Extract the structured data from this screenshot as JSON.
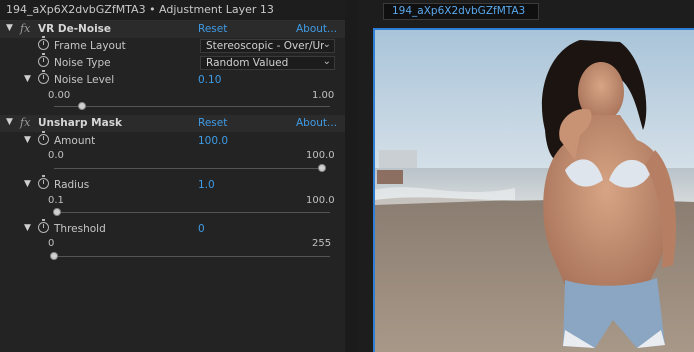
{
  "panel": {
    "title": "194_aXp6X2dvbGZfMTA3 • Adjustment Layer 13"
  },
  "effects": [
    {
      "name": "VR De-Noise",
      "reset": "Reset",
      "about": "About...",
      "params": {
        "frame_layout": {
          "label": "Frame Layout",
          "value": "Stereoscopic - Over/Under"
        },
        "noise_type": {
          "label": "Noise Type",
          "value": "Random Valued"
        },
        "noise_level": {
          "label": "Noise Level",
          "value": "0.10",
          "min": "0.00",
          "max": "1.00",
          "fraction": 0.1
        }
      }
    },
    {
      "name": "Unsharp Mask",
      "reset": "Reset",
      "about": "About...",
      "params": {
        "amount": {
          "label": "Amount",
          "value": "100.0",
          "min": "0.0",
          "max": "100.0",
          "fraction": 1.0
        },
        "radius": {
          "label": "Radius",
          "value": "1.0",
          "min": "0.1",
          "max": "100.0",
          "fraction": 0.01
        },
        "threshold": {
          "label": "Threshold",
          "value": "0",
          "min": "0",
          "max": "255",
          "fraction": 0.0
        }
      }
    }
  ],
  "composition": {
    "tab": "194_aXp6X2dvbGZfMTA3"
  },
  "colors": {
    "accent": "#3f9be6",
    "panel_bg": "#232323",
    "viewer_border": "#2f7fd6"
  }
}
